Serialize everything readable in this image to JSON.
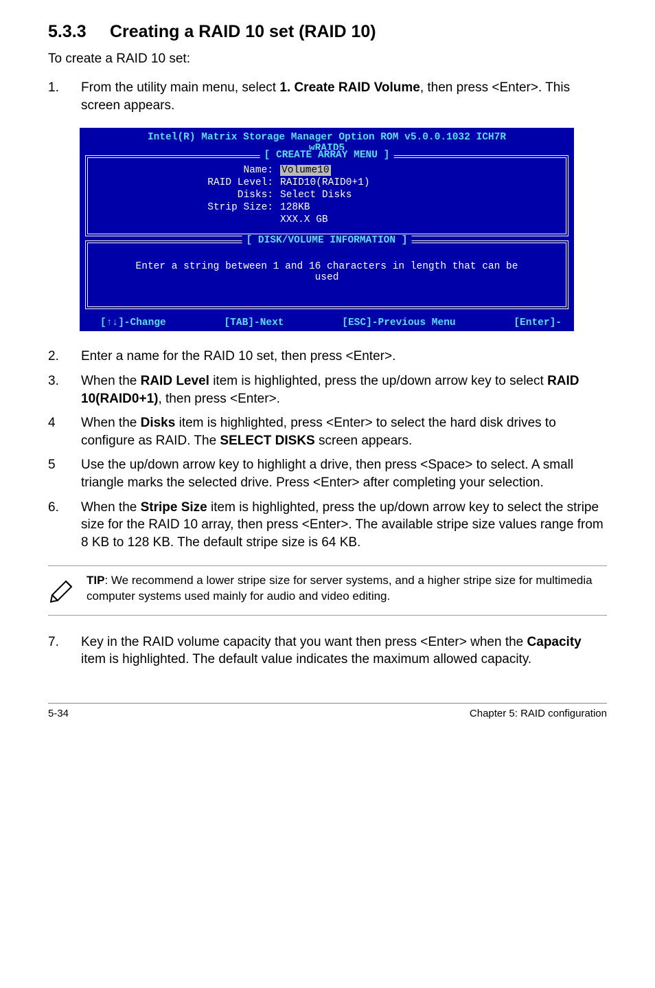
{
  "heading": {
    "num": "5.3.3",
    "title": "Creating a RAID 10 set (RAID 10)"
  },
  "intro": "To create a RAID 10 set:",
  "step1": {
    "num": "1.",
    "t1": "From the utility main menu, select ",
    "b1": "1. Create RAID Volume",
    "t2": ", then press <Enter>. This screen appears."
  },
  "bios": {
    "title": "Intel(R) Matrix Storage Manager Option ROM v5.0.0.1032 ICH7R",
    "subtitle": "wRAID5",
    "create_label": "[ CREATE ARRAY MENU ]",
    "rows": {
      "name_l": "Name:",
      "name_v": "Volume10",
      "level_l": "RAID Level:",
      "level_v": "RAID10(RAID0+1)",
      "disks_l": "Disks:",
      "disks_v": "Select Disks",
      "strip_l": "Strip Size:",
      "strip_v": "128KB",
      "cap_l": "",
      "cap_v": "XXX.X GB"
    },
    "disk_label": "[ DISK/VOLUME INFORMATION ]",
    "disk_text1": "Enter a string between 1 and 16 characters in length that can be",
    "disk_text2": "used",
    "footer": {
      "change": "[↑↓]-Change",
      "tab": "[TAB]-Next",
      "esc": "[ESC]-Previous Menu",
      "enter": "[Enter]-"
    }
  },
  "step2": {
    "num": "2.",
    "text": "Enter a name for the RAID 10 set, then press <Enter>."
  },
  "step3": {
    "num": "3.",
    "t1": "When the ",
    "b1": "RAID Level",
    "t2": " item is highlighted, press the up/down arrow key to select ",
    "b2": "RAID 10(RAID0+1)",
    "t3": ", then press <Enter>."
  },
  "step4": {
    "num": "4",
    "t1": "When the ",
    "b1": "Disks",
    "t2": " item is highlighted, press <Enter> to select the hard disk drives to configure as RAID. The ",
    "b2": "SELECT DISKS",
    "t3": " screen appears."
  },
  "step5": {
    "num": "5",
    "text": "Use the up/down arrow key to highlight a drive, then press <Space>  to select. A small triangle marks the selected drive. Press <Enter> after completing your selection."
  },
  "step6": {
    "num": "6.",
    "t1": "When the ",
    "b1": "Stripe Size",
    "t2": " item is highlighted, press the up/down arrow key to select the stripe size for the RAID 10 array, then press <Enter>. The available stripe size values range from 8 KB to 128 KB. The default stripe size is 64 KB."
  },
  "tip": {
    "b": "TIP",
    "text": ": We recommend a lower stripe size for server systems, and a higher stripe size for multimedia computer systems used mainly for audio and video editing."
  },
  "step7": {
    "num": "7.",
    "t1": "Key in the RAID volume capacity that you want then press <Enter> when the ",
    "b1": "Capacity",
    "t2": " item is highlighted. The default value indicates the maximum allowed capacity."
  },
  "footer": {
    "left": "5-34",
    "right": "Chapter 5: RAID configuration"
  }
}
